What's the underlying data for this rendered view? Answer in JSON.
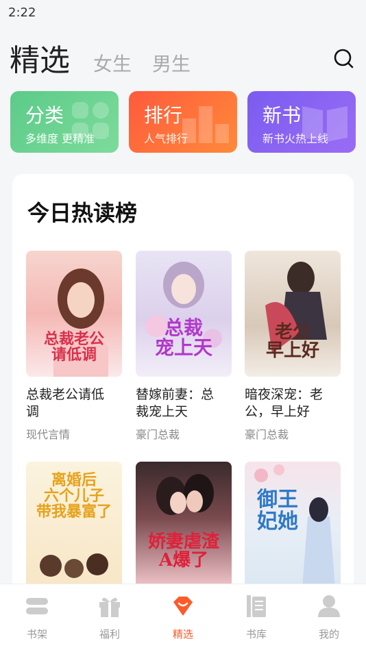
{
  "status_bar": {
    "time": "2:22"
  },
  "top_nav": {
    "tabs": [
      {
        "label": "精选",
        "active": true
      },
      {
        "label": "女生",
        "active": false
      },
      {
        "label": "男生",
        "active": false
      }
    ],
    "search_icon": "search-icon"
  },
  "quick_entries": [
    {
      "title": "分类",
      "subtitle": "多维度 更精准",
      "color": "#5ccb8a"
    },
    {
      "title": "排行",
      "subtitle": "人气排行",
      "color": "#ff6a3c"
    },
    {
      "title": "新书",
      "subtitle": "新书火热上线",
      "color": "#8a60f2"
    }
  ],
  "hot_list": {
    "title": "今日热读榜",
    "books": [
      {
        "name": "总裁老公请低调",
        "genre": "现代言情",
        "cover_text": "总裁老公\n请低调"
      },
      {
        "name": "替嫁前妻：总裁宠上天",
        "genre": "豪门总裁",
        "cover_text": "总裁\n宠上天"
      },
      {
        "name": "暗夜深宠：老公，早上好",
        "genre": "豪门总裁",
        "cover_text": "老公\n早上好"
      },
      {
        "name": "",
        "genre": "",
        "cover_text": "离婚后\n六个儿子\n带我暴富了"
      },
      {
        "name": "",
        "genre": "",
        "cover_text": "娇妻虐渣\nA爆了"
      },
      {
        "name": "",
        "genre": "",
        "cover_text": "御王\n妃她"
      }
    ]
  },
  "bottom_nav": {
    "items": [
      {
        "label": "书架",
        "icon": "bookshelf-icon",
        "active": false
      },
      {
        "label": "福利",
        "icon": "gift-icon",
        "active": false
      },
      {
        "label": "精选",
        "icon": "featured-icon",
        "active": true
      },
      {
        "label": "书库",
        "icon": "library-icon",
        "active": false
      },
      {
        "label": "我的",
        "icon": "profile-icon",
        "active": false
      }
    ],
    "active_color": "#ff5a2a"
  }
}
